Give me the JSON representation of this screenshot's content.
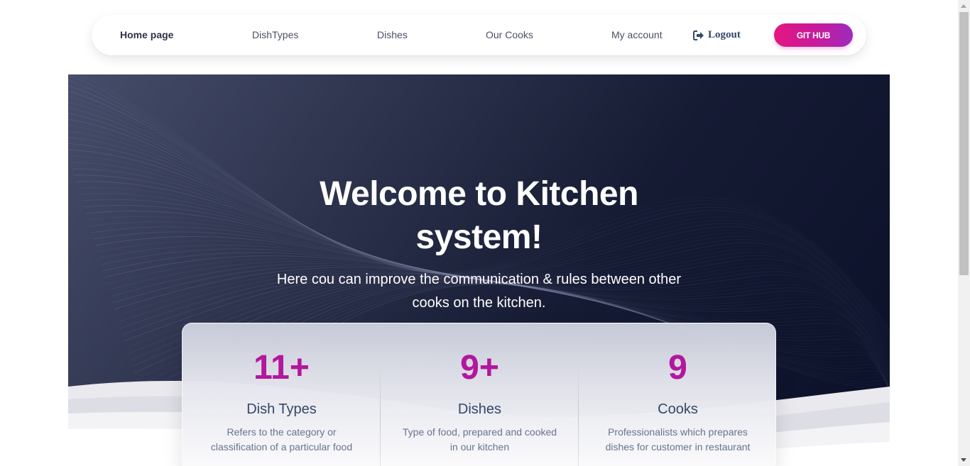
{
  "nav": {
    "links": [
      "Home page",
      "DishTypes",
      "Dishes",
      "Our Cooks",
      "My account"
    ],
    "logout_label": "Logout",
    "github_label": "GIT HUB",
    "accent": "#e3177f",
    "accent_end": "#9c2bbd"
  },
  "hero": {
    "title_line1": "Welcome to Kitchen",
    "title_line2": "system!",
    "subtitle": "Here cou can improve the communication & rules between other cooks on the kitchen."
  },
  "stats": [
    {
      "number": "11+",
      "title": "Dish Types",
      "description": "Refers to the category or classification of a particular food"
    },
    {
      "number": "9+",
      "title": "Dishes",
      "description": "Type of food, prepared and cooked in our kitchen"
    },
    {
      "number": "9",
      "title": "Cooks",
      "description": "Professionalists which prepares dishes for customer in restaurant"
    }
  ],
  "icons": {
    "logout": "logout-icon"
  }
}
